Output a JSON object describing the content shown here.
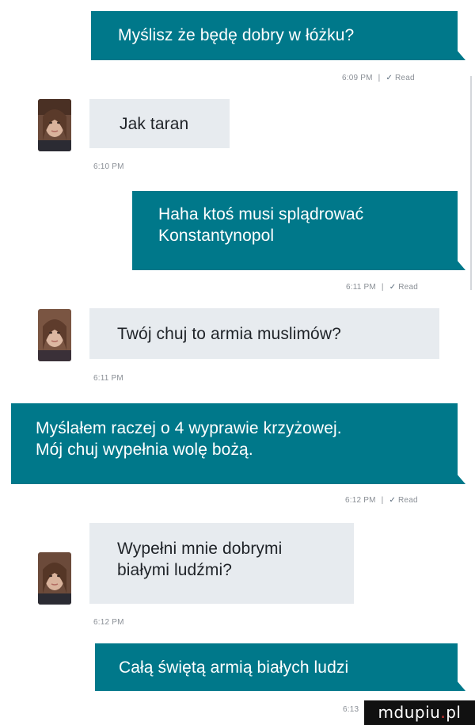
{
  "messages": [
    {
      "kind": "out",
      "lines": [
        "Myślisz że będę dobry w łóżku?"
      ],
      "meta": "6:09 PM",
      "status": "Read"
    },
    {
      "kind": "in",
      "lines": [
        "Jak taran"
      ],
      "meta": "6:10 PM",
      "avatar": "contact-avatar"
    },
    {
      "kind": "out",
      "lines": [
        "Haha ktoś musi splądrować",
        "Konstantynopol"
      ],
      "meta": "6:11 PM",
      "status": "Read"
    },
    {
      "kind": "in",
      "lines": [
        "Twój chuj to armia muslimów?"
      ],
      "meta": "6:11 PM",
      "avatar": "contact-avatar"
    },
    {
      "kind": "out",
      "lines": [
        "Myślałem raczej o 4 wyprawie krzyżowej.",
        "Mój chuj wypełnia wolę bożą."
      ],
      "meta": "6:12 PM",
      "status": "Read"
    },
    {
      "kind": "in",
      "lines": [
        "Wypełni mnie dobrymi",
        "białymi ludźmi?"
      ],
      "meta": "6:12 PM",
      "avatar": "contact-avatar"
    },
    {
      "kind": "out",
      "lines": [
        "Całą świętą armią białych ludzi"
      ],
      "meta": "6:13"
    }
  ],
  "read_check_icon": "checkmark-icon",
  "colors": {
    "outgoing_bubble": "#00788a",
    "incoming_bubble": "#e7ebef",
    "meta_text": "#8a8f96"
  },
  "watermark": {
    "text_main": "mdupiu",
    "dot": ".",
    "tld": "pl"
  }
}
